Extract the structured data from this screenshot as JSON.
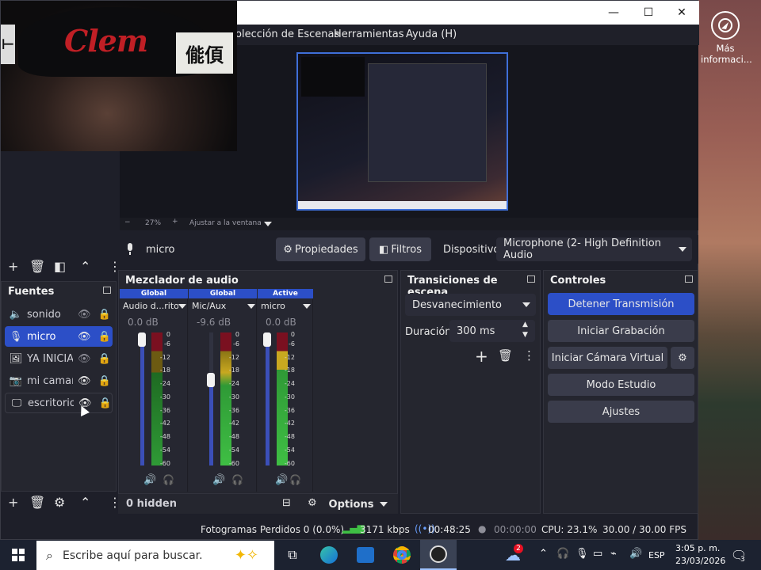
{
  "desktop": {
    "icon_label": "Más informaci..."
  },
  "window": {
    "minimize": "—",
    "maximize": "☐",
    "close": "✕"
  },
  "menu": {
    "scene_collection": "olección de Escenas",
    "tools": "Herramientas",
    "help": "Ayuda (H)"
  },
  "webcam": {
    "cap_text": "Clem",
    "sign_text": "㑷㑯"
  },
  "zoom": {
    "minus": "−",
    "value": "27%",
    "plus": "+",
    "fit": "Ajustar a la ventana"
  },
  "source_toolbar": {
    "source_name": "micro",
    "properties": "Propiedades",
    "filters": "Filtros",
    "device_label": "Dispositivo",
    "device_value": "Microphone (2- High Definition Audio"
  },
  "sources": {
    "title": "Fuentes",
    "items": [
      {
        "name": "sonido",
        "icon": "speaker-icon",
        "visible": false
      },
      {
        "name": "micro",
        "icon": "mic-icon",
        "visible": true,
        "selected": true
      },
      {
        "name": "YA INICIAMOS",
        "icon": "image-icon",
        "visible": false
      },
      {
        "name": "mi camara",
        "icon": "camera-icon",
        "visible": true
      },
      {
        "name": "escritorio",
        "icon": "monitor-icon",
        "visible": true
      }
    ]
  },
  "mixer": {
    "title": "Mezclador de audio",
    "channels": [
      {
        "tag": "Global",
        "name": "Audio d...ritorio",
        "db": "0.0 dB",
        "level": 0.0
      },
      {
        "tag": "Global",
        "name": "Mic/Aux",
        "db": "-9.6 dB",
        "level": 0.62
      },
      {
        "tag": "Active",
        "name": "micro",
        "db": "0.0 dB",
        "level": 0.35
      }
    ],
    "scale": [
      "0",
      "-6",
      "-12",
      "-18",
      "-24",
      "-30",
      "-36",
      "-42",
      "-48",
      "-54",
      "-60"
    ],
    "hidden": "0 hidden",
    "options": "Options"
  },
  "transitions": {
    "title": "Transiciones de escena",
    "type": "Desvanecimiento",
    "duration_label": "Duración",
    "duration_value": "300 ms"
  },
  "controls": {
    "title": "Controles",
    "stop_stream": "Detener Transmisión",
    "start_recording": "Iniciar Grabación",
    "virtual_cam": "Iniciar Cámara Virtual",
    "studio_mode": "Modo Estudio",
    "settings": "Ajustes"
  },
  "status": {
    "dropped": "Fotogramas Perdidos 0 (0.0%)",
    "bitrate": "3171 kbps",
    "stream_time": "00:48:25",
    "rec_time": "00:00:00",
    "cpu": "CPU: 23.1%",
    "fps": "30.00 / 30.00 FPS"
  },
  "taskbar": {
    "search_placeholder": "Escribe aquí para buscar.",
    "weather_badge": "2",
    "lang": "ESP",
    "time": "3:05 p. m.",
    "date": "23/03/2026",
    "notif_count": "3"
  },
  "colors": {
    "accent": "#2c4fc7",
    "panel": "#25262f",
    "bg": "#1e1f29"
  }
}
